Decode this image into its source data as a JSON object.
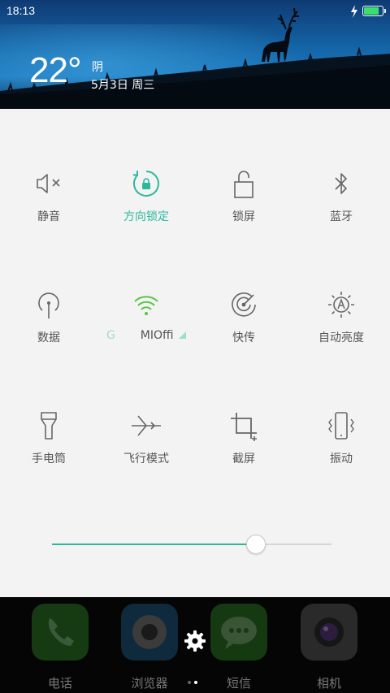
{
  "status_bar": {
    "time": "18:13",
    "battery_level": 0.9,
    "charging": true
  },
  "weather": {
    "temperature": "22°",
    "condition": "阴",
    "date": "5月3日 周三"
  },
  "quick_settings": {
    "row1": [
      {
        "label": "静音",
        "icon": "mute-icon",
        "active": false
      },
      {
        "label": "方向锁定",
        "icon": "rotation-lock-icon",
        "active": true
      },
      {
        "label": "锁屏",
        "icon": "lock-icon",
        "active": false
      },
      {
        "label": "蓝牙",
        "icon": "bluetooth-icon",
        "active": false
      }
    ],
    "row2": [
      {
        "label": "数据",
        "icon": "mobile-data-icon",
        "active": false
      },
      {
        "label_faded": "G",
        "label": "MIOff",
        "label_tail": "i",
        "icon": "wifi-icon",
        "active": true
      },
      {
        "label": "快传",
        "icon": "fast-transfer-icon",
        "active": false
      },
      {
        "label": "自动亮度",
        "icon": "auto-brightness-icon",
        "active": false
      }
    ],
    "row3": [
      {
        "label": "手电筒",
        "icon": "flashlight-icon",
        "active": false
      },
      {
        "label": "飞行模式",
        "icon": "airplane-mode-icon",
        "active": false
      },
      {
        "label": "截屏",
        "icon": "screenshot-icon",
        "active": false
      },
      {
        "label": "振动",
        "icon": "vibrate-icon",
        "active": false
      }
    ]
  },
  "brightness": {
    "value": 0.73,
    "accent": "#2bb89c"
  },
  "dock": {
    "apps": [
      {
        "label": "电话",
        "icon": "phone-icon"
      },
      {
        "label": "浏览器",
        "icon": "browser-icon"
      },
      {
        "label": "短信",
        "icon": "messages-icon"
      },
      {
        "label": "相机",
        "icon": "camera-icon"
      }
    ],
    "settings_icon": "gear-icon",
    "page_indicator": {
      "pages": 2,
      "current": 1
    }
  }
}
